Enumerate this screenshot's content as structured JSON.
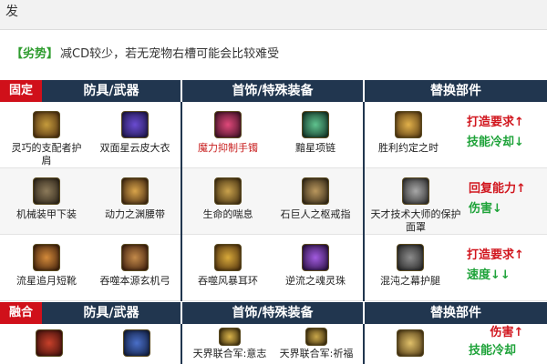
{
  "top": {
    "text": "发"
  },
  "note": {
    "tag": "【劣势】",
    "text": "减CD较少，若无宠物右槽可能会比较难受"
  },
  "sections": [
    {
      "tag": "固定",
      "headers": [
        "防具/武器",
        "首饰/特殊装备",
        "替换部件"
      ],
      "rows": [
        {
          "armor": [
            "灵巧的支配者护肩",
            "双面星云皮大衣"
          ],
          "jewelry": [
            "魔力抑制手镯",
            "黯星项链"
          ],
          "replace": "胜利约定之时",
          "effects": [
            [
              "打造要求↑",
              "red"
            ],
            [
              "技能冷却↓",
              "green"
            ]
          ]
        },
        {
          "armor": [
            "机械装甲下装",
            "动力之渊腰带"
          ],
          "jewelry": [
            "生命的喘息",
            "石巨人之枢戒指"
          ],
          "replace": "天才技术大师的保护面罩",
          "effects": [
            [
              "回复能力↑",
              "red"
            ],
            [
              "伤害↓",
              "green"
            ]
          ]
        },
        {
          "armor": [
            "流星追月短靴",
            "吞噬本源玄机弓"
          ],
          "jewelry": [
            "吞噬风暴耳环",
            "逆流之魂灵珠"
          ],
          "replace": "混沌之幕护腿",
          "effects": [
            [
              "打造要求↑",
              "red"
            ],
            [
              "速度↓↓",
              "green"
            ]
          ]
        }
      ]
    },
    {
      "tag": "融合",
      "headers": [
        "防具/武器",
        "首饰/特殊装备",
        "替换部件"
      ],
      "rows": [
        {
          "armor": [
            "",
            ""
          ],
          "jewelry": [
            "天界联合军:意志",
            "天界联合军:祈福"
          ],
          "replace": "",
          "effects": [
            [
              "伤害↑",
              "red"
            ],
            [
              "技能冷却",
              "green"
            ]
          ]
        }
      ]
    }
  ],
  "colors": {
    "header_bg": "#21364f",
    "tag_bg": "#d0101a",
    "positive": "#d1161e",
    "negative": "#1fa33a"
  },
  "icons": [
    "shoulder-armor-icon",
    "coat-icon",
    "bracelet-icon",
    "necklace-icon",
    "ring-gem-icon",
    "leg-armor-icon",
    "belt-icon",
    "breath-icon",
    "stone-ring-icon",
    "helmet-icon",
    "boots-icon",
    "bow-icon",
    "earring-icon",
    "soul-orb-icon",
    "legguard-icon"
  ]
}
